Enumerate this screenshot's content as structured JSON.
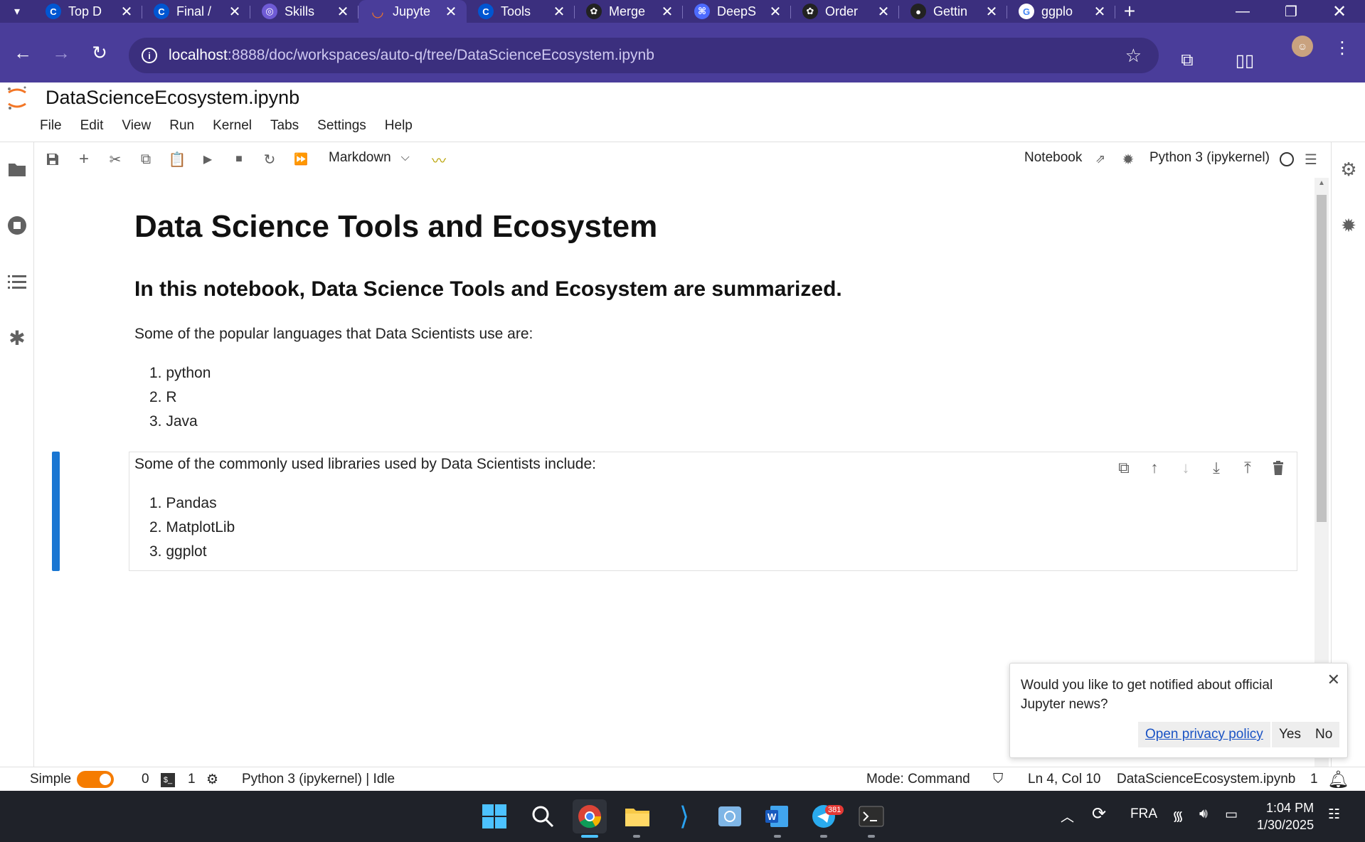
{
  "browser": {
    "tabs": [
      {
        "title": "Top D",
        "icon": "coursera-icon",
        "color": "#0056d2",
        "letter": "C"
      },
      {
        "title": "Final /",
        "icon": "coursera-icon",
        "color": "#0056d2",
        "letter": "C"
      },
      {
        "title": "Skills",
        "icon": "skills-network-icon",
        "color": "#6f5bd6",
        "letter": "◎"
      },
      {
        "title": "Jupyte",
        "icon": "jupyter-icon",
        "color": "#f37626",
        "letter": "◡"
      },
      {
        "title": "Tools",
        "icon": "coursera-icon",
        "color": "#0056d2",
        "letter": "C"
      },
      {
        "title": "Merge",
        "icon": "chatgpt-icon",
        "color": "#222222",
        "letter": "✿"
      },
      {
        "title": "DeepS",
        "icon": "deepseek-icon",
        "color": "#4d6bfe",
        "letter": "⌘"
      },
      {
        "title": "Order",
        "icon": "chatgpt-icon",
        "color": "#222222",
        "letter": "✿"
      },
      {
        "title": "Gettin",
        "icon": "github-icon",
        "color": "#222222",
        "letter": "●"
      },
      {
        "title": "ggplo",
        "icon": "google-icon",
        "color": "#ffffff",
        "letter": "G"
      }
    ],
    "new_tab": "+",
    "url_host": "localhost",
    "url_path": ":8888/doc/workspaces/auto-q/tree/DataScienceEcosystem.ipynb"
  },
  "jupyter": {
    "notebook_title": "DataScienceEcosystem.ipynb",
    "menu": [
      "File",
      "Edit",
      "View",
      "Run",
      "Kernel",
      "Tabs",
      "Settings",
      "Help"
    ],
    "cell_type": "Markdown",
    "notebook_label": "Notebook",
    "kernel_name": "Python 3 (ipykernel)"
  },
  "notebook": {
    "h1": "Data Science Tools and Ecosystem",
    "h2": "In this notebook, Data Science Tools and Ecosystem are summarized.",
    "languages_intro": "Some of the popular languages that Data Scientists use are:",
    "languages": [
      "1. python",
      "2. R",
      "3. Java"
    ],
    "libraries_intro": "Some of the commonly used libraries used by Data Scientists include:",
    "libraries": [
      "1. Pandas",
      "2. MatplotLib",
      "3. ggplot"
    ]
  },
  "notification": {
    "message": "Would you like to get notified about official Jupyter news?",
    "privacy_link": "Open privacy policy",
    "yes": "Yes",
    "no": "No"
  },
  "status": {
    "mode_label": "Simple",
    "terminals_count": "0",
    "kernels_count": "1",
    "kernel_status": "Python 3 (ipykernel) | Idle",
    "mode": "Mode: Command",
    "cursor": "Ln 4, Col 10",
    "filename": "DataScienceEcosystem.ipynb",
    "notifications_count": "1"
  },
  "taskbar": {
    "lang": "FRA",
    "time": "1:04 PM",
    "date": "1/30/2025",
    "telegram_badge": "381"
  },
  "colors": {
    "browser_frame": "#3b2f7e",
    "accent_blue": "#1976d2",
    "jupyter_orange": "#f37626"
  }
}
